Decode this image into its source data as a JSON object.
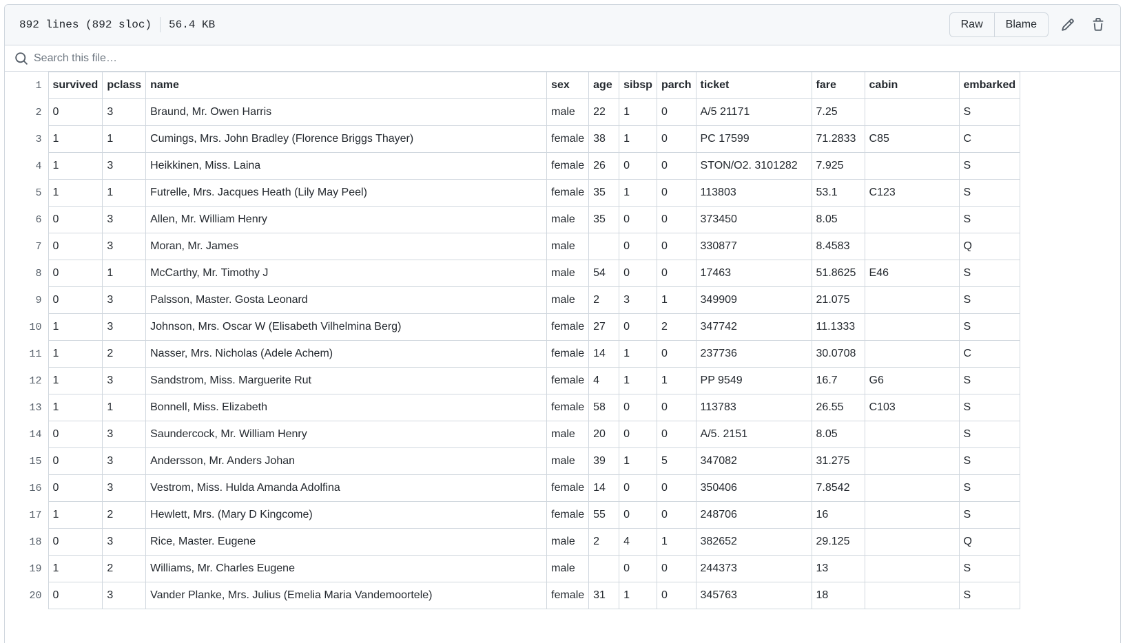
{
  "file_info": {
    "lines": "892 lines (892 sloc)",
    "size": "56.4 KB"
  },
  "actions": {
    "raw_label": "Raw",
    "blame_label": "Blame",
    "edit_icon": "pencil-icon",
    "delete_icon": "trash-icon"
  },
  "search": {
    "placeholder": "Search this file…",
    "icon": "search-icon"
  },
  "table": {
    "columns": [
      "survived",
      "pclass",
      "name",
      "sex",
      "age",
      "sibsp",
      "parch",
      "ticket",
      "fare",
      "cabin",
      "embarked"
    ],
    "rows": [
      [
        "0",
        "3",
        "Braund, Mr. Owen Harris",
        "male",
        "22",
        "1",
        "0",
        "A/5 21171",
        "7.25",
        "",
        "S"
      ],
      [
        "1",
        "1",
        "Cumings, Mrs. John Bradley (Florence Briggs Thayer)",
        "female",
        "38",
        "1",
        "0",
        "PC 17599",
        "71.2833",
        "C85",
        "C"
      ],
      [
        "1",
        "3",
        "Heikkinen, Miss. Laina",
        "female",
        "26",
        "0",
        "0",
        "STON/O2. 3101282",
        "7.925",
        "",
        "S"
      ],
      [
        "1",
        "1",
        "Futrelle, Mrs. Jacques Heath (Lily May Peel)",
        "female",
        "35",
        "1",
        "0",
        "113803",
        "53.1",
        "C123",
        "S"
      ],
      [
        "0",
        "3",
        "Allen, Mr. William Henry",
        "male",
        "35",
        "0",
        "0",
        "373450",
        "8.05",
        "",
        "S"
      ],
      [
        "0",
        "3",
        "Moran, Mr. James",
        "male",
        "",
        "0",
        "0",
        "330877",
        "8.4583",
        "",
        "Q"
      ],
      [
        "0",
        "1",
        "McCarthy, Mr. Timothy J",
        "male",
        "54",
        "0",
        "0",
        "17463",
        "51.8625",
        "E46",
        "S"
      ],
      [
        "0",
        "3",
        "Palsson, Master. Gosta Leonard",
        "male",
        "2",
        "3",
        "1",
        "349909",
        "21.075",
        "",
        "S"
      ],
      [
        "1",
        "3",
        "Johnson, Mrs. Oscar W (Elisabeth Vilhelmina Berg)",
        "female",
        "27",
        "0",
        "2",
        "347742",
        "11.1333",
        "",
        "S"
      ],
      [
        "1",
        "2",
        "Nasser, Mrs. Nicholas (Adele Achem)",
        "female",
        "14",
        "1",
        "0",
        "237736",
        "30.0708",
        "",
        "C"
      ],
      [
        "1",
        "3",
        "Sandstrom, Miss. Marguerite Rut",
        "female",
        "4",
        "1",
        "1",
        "PP 9549",
        "16.7",
        "G6",
        "S"
      ],
      [
        "1",
        "1",
        "Bonnell, Miss. Elizabeth",
        "female",
        "58",
        "0",
        "0",
        "113783",
        "26.55",
        "C103",
        "S"
      ],
      [
        "0",
        "3",
        "Saundercock, Mr. William Henry",
        "male",
        "20",
        "0",
        "0",
        "A/5. 2151",
        "8.05",
        "",
        "S"
      ],
      [
        "0",
        "3",
        "Andersson, Mr. Anders Johan",
        "male",
        "39",
        "1",
        "5",
        "347082",
        "31.275",
        "",
        "S"
      ],
      [
        "0",
        "3",
        "Vestrom, Miss. Hulda Amanda Adolfina",
        "female",
        "14",
        "0",
        "0",
        "350406",
        "7.8542",
        "",
        "S"
      ],
      [
        "1",
        "2",
        "Hewlett, Mrs. (Mary D Kingcome)",
        "female",
        "55",
        "0",
        "0",
        "248706",
        "16",
        "",
        "S"
      ],
      [
        "0",
        "3",
        "Rice, Master. Eugene",
        "male",
        "2",
        "4",
        "1",
        "382652",
        "29.125",
        "",
        "Q"
      ],
      [
        "1",
        "2",
        "Williams, Mr. Charles Eugene",
        "male",
        "",
        "0",
        "0",
        "244373",
        "13",
        "",
        "S"
      ],
      [
        "0",
        "3",
        "Vander Planke, Mrs. Julius (Emelia Maria Vandemoortele)",
        "female",
        "31",
        "1",
        "0",
        "345763",
        "18",
        "",
        "S"
      ]
    ]
  },
  "colors": {
    "border": "#d0d7de",
    "header_bg": "#f6f8fa",
    "text": "#24292f",
    "line_number": "#57606a"
  }
}
